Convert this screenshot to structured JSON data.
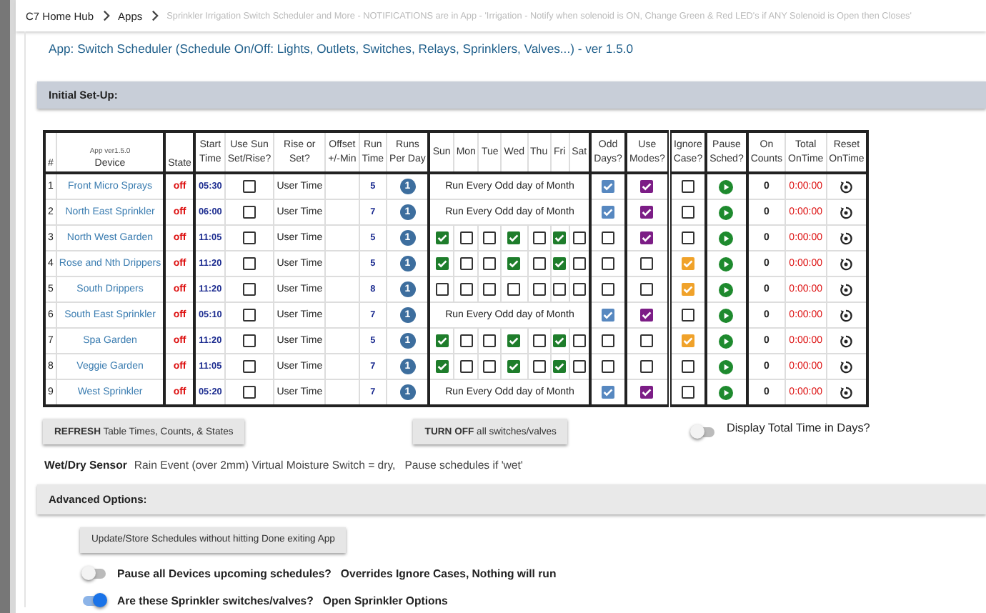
{
  "breadcrumb": [
    "C7 Home Hub",
    "Apps",
    "Sprinkler Irrigation Switch Scheduler and More - NOTIFICATIONS are in App - 'Irrigation - Notify when solenoid is ON, Change Green & Red LED's if ANY Solenoid is Open then Closes'"
  ],
  "app_title": "App: Switch Scheduler (Schedule On/Off: Lights, Outlets, Switches, Relays, Sprinklers, Valves...) - ver 1.5.0",
  "initial_setup": {
    "title": "Initial Set-Up:",
    "table": {
      "version_note": "App ver1.5.0",
      "columns": [
        [
          "#"
        ],
        [
          "Device"
        ],
        [
          "State"
        ],
        [
          "Start",
          "Time"
        ],
        [
          "Use Sun",
          "Set/Rise?"
        ],
        [
          "Rise or",
          "Set?"
        ],
        [
          "Offset",
          "+/-Min"
        ],
        [
          "Run",
          "Time"
        ],
        [
          "Runs",
          "Per Day"
        ],
        [
          "Sun"
        ],
        [
          "Mon"
        ],
        [
          "Tue"
        ],
        [
          "Wed"
        ],
        [
          "Thu"
        ],
        [
          "Fri"
        ],
        [
          "Sat"
        ],
        [
          "Odd",
          "Days?"
        ],
        [
          "Use",
          "Modes?"
        ],
        [
          "Ignore",
          "Case?"
        ],
        [
          "Pause",
          "Sched?"
        ],
        [
          "On",
          "Counts"
        ],
        [
          "Total",
          "OnTime"
        ],
        [
          "Reset",
          "OnTime"
        ]
      ],
      "rows": [
        {
          "num": "1",
          "device": "Front Micro Sprays",
          "state": "off",
          "start": "05:30",
          "use_sun": false,
          "rise_set": "User Time",
          "run_time": "5",
          "runs_per_day": "1",
          "kind": "odd",
          "odd_text": "Run Every Odd day of Month",
          "odd_days": true,
          "use_modes": true,
          "ignore_case": false,
          "on_counts": "0",
          "total_ontime": "0:00:00"
        },
        {
          "num": "2",
          "device": "North East Sprinkler",
          "state": "off",
          "start": "06:00",
          "use_sun": false,
          "rise_set": "User Time",
          "run_time": "7",
          "runs_per_day": "1",
          "kind": "odd",
          "odd_text": "Run Every Odd day of Month",
          "odd_days": true,
          "use_modes": true,
          "ignore_case": false,
          "on_counts": "0",
          "total_ontime": "0:00:00"
        },
        {
          "num": "3",
          "device": "North West Garden",
          "state": "off",
          "start": "11:05",
          "use_sun": false,
          "rise_set": "User Time",
          "run_time": "5",
          "runs_per_day": "1",
          "kind": "weekly",
          "days": [
            true,
            false,
            false,
            true,
            false,
            true,
            false
          ],
          "odd_days": false,
          "use_modes": true,
          "ignore_case": false,
          "on_counts": "0",
          "total_ontime": "0:00:00"
        },
        {
          "num": "4",
          "device": "Rose and Nth Drippers",
          "state": "off",
          "start": "11:20",
          "use_sun": false,
          "rise_set": "User Time",
          "run_time": "5",
          "runs_per_day": "1",
          "kind": "weekly",
          "days": [
            true,
            false,
            false,
            true,
            false,
            true,
            false
          ],
          "odd_days": false,
          "use_modes": false,
          "ignore_case": true,
          "on_counts": "0",
          "total_ontime": "0:00:00"
        },
        {
          "num": "5",
          "device": "South Drippers",
          "state": "off",
          "start": "11:20",
          "use_sun": false,
          "rise_set": "User Time",
          "run_time": "8",
          "runs_per_day": "1",
          "kind": "weekly",
          "days": [
            false,
            false,
            false,
            false,
            false,
            false,
            false
          ],
          "odd_days": false,
          "use_modes": false,
          "ignore_case": true,
          "on_counts": "0",
          "total_ontime": "0:00:00"
        },
        {
          "num": "6",
          "device": "South East Sprinkler",
          "state": "off",
          "start": "05:10",
          "use_sun": false,
          "rise_set": "User Time",
          "run_time": "7",
          "runs_per_day": "1",
          "kind": "odd",
          "odd_text": "Run Every Odd day of Month",
          "odd_days": true,
          "use_modes": true,
          "ignore_case": false,
          "on_counts": "0",
          "total_ontime": "0:00:00"
        },
        {
          "num": "7",
          "device": "Spa Garden",
          "state": "off",
          "start": "11:20",
          "use_sun": false,
          "rise_set": "User Time",
          "run_time": "5",
          "runs_per_day": "1",
          "kind": "weekly",
          "days": [
            true,
            false,
            false,
            true,
            false,
            true,
            false
          ],
          "odd_days": false,
          "use_modes": false,
          "ignore_case": true,
          "on_counts": "0",
          "total_ontime": "0:00:00"
        },
        {
          "num": "8",
          "device": "Veggie Garden",
          "state": "off",
          "start": "11:05",
          "use_sun": false,
          "rise_set": "User Time",
          "run_time": "7",
          "runs_per_day": "1",
          "kind": "weekly",
          "days": [
            true,
            false,
            false,
            true,
            false,
            true,
            false
          ],
          "odd_days": false,
          "use_modes": false,
          "ignore_case": false,
          "on_counts": "0",
          "total_ontime": "0:00:00"
        },
        {
          "num": "9",
          "device": "West Sprinkler",
          "state": "off",
          "start": "05:20",
          "use_sun": false,
          "rise_set": "User Time",
          "run_time": "7",
          "runs_per_day": "1",
          "kind": "odd",
          "odd_text": "Run Every Odd day of Month",
          "odd_days": true,
          "use_modes": true,
          "ignore_case": false,
          "on_counts": "0",
          "total_ontime": "0:00:00"
        }
      ]
    },
    "refresh_button": "**REFRESH** Table Times, Counts, & States",
    "turn_off_button": "**TURN OFF** all switches/valves",
    "display_days_toggle": {
      "label": "Display Total Time in Days?",
      "on": false
    },
    "wet_dry": {
      "label": "Wet/Dry Sensor",
      "value": "Rain Event (over 2mm) Virtual Moisture Switch = dry,   Pause schedules if 'wet'"
    }
  },
  "advanced_options": {
    "title": "Advanced Options:",
    "update_button": "Update/Store Schedules without hitting Done exiting App",
    "toggles": [
      {
        "label": "Pause all Devices upcoming schedules?   Overrides Ignore Cases, Nothing will run",
        "on": false
      },
      {
        "label": "Are these Sprinkler switches/valves?   Open Sprinkler Options",
        "on": true
      }
    ]
  }
}
